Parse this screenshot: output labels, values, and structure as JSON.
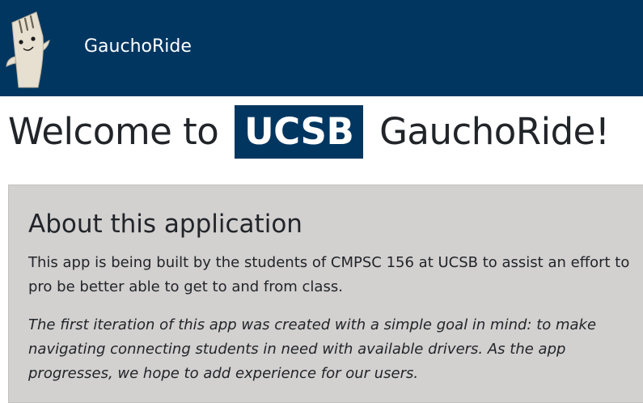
{
  "navbar": {
    "brand": "GauchoRide",
    "logo_icon": "fork-mascot-icon",
    "background_color": "#003660"
  },
  "welcome": {
    "prefix": "Welcome to",
    "badge": "UCSB",
    "suffix": "GauchoRide!"
  },
  "about": {
    "heading": "About this application",
    "paragraph1": "This app is being built by the students of CMPSC 156 at UCSB to assist an effort to pro be better able to get to and from class.",
    "paragraph2": "The first iteration of this app was created with a simple goal in mind: to make navigating connecting students in need with available drivers. As the app progresses, we hope to add experience for our users."
  },
  "colors": {
    "brand_navy": "#003660",
    "panel_gray": "#d3d0d0"
  }
}
